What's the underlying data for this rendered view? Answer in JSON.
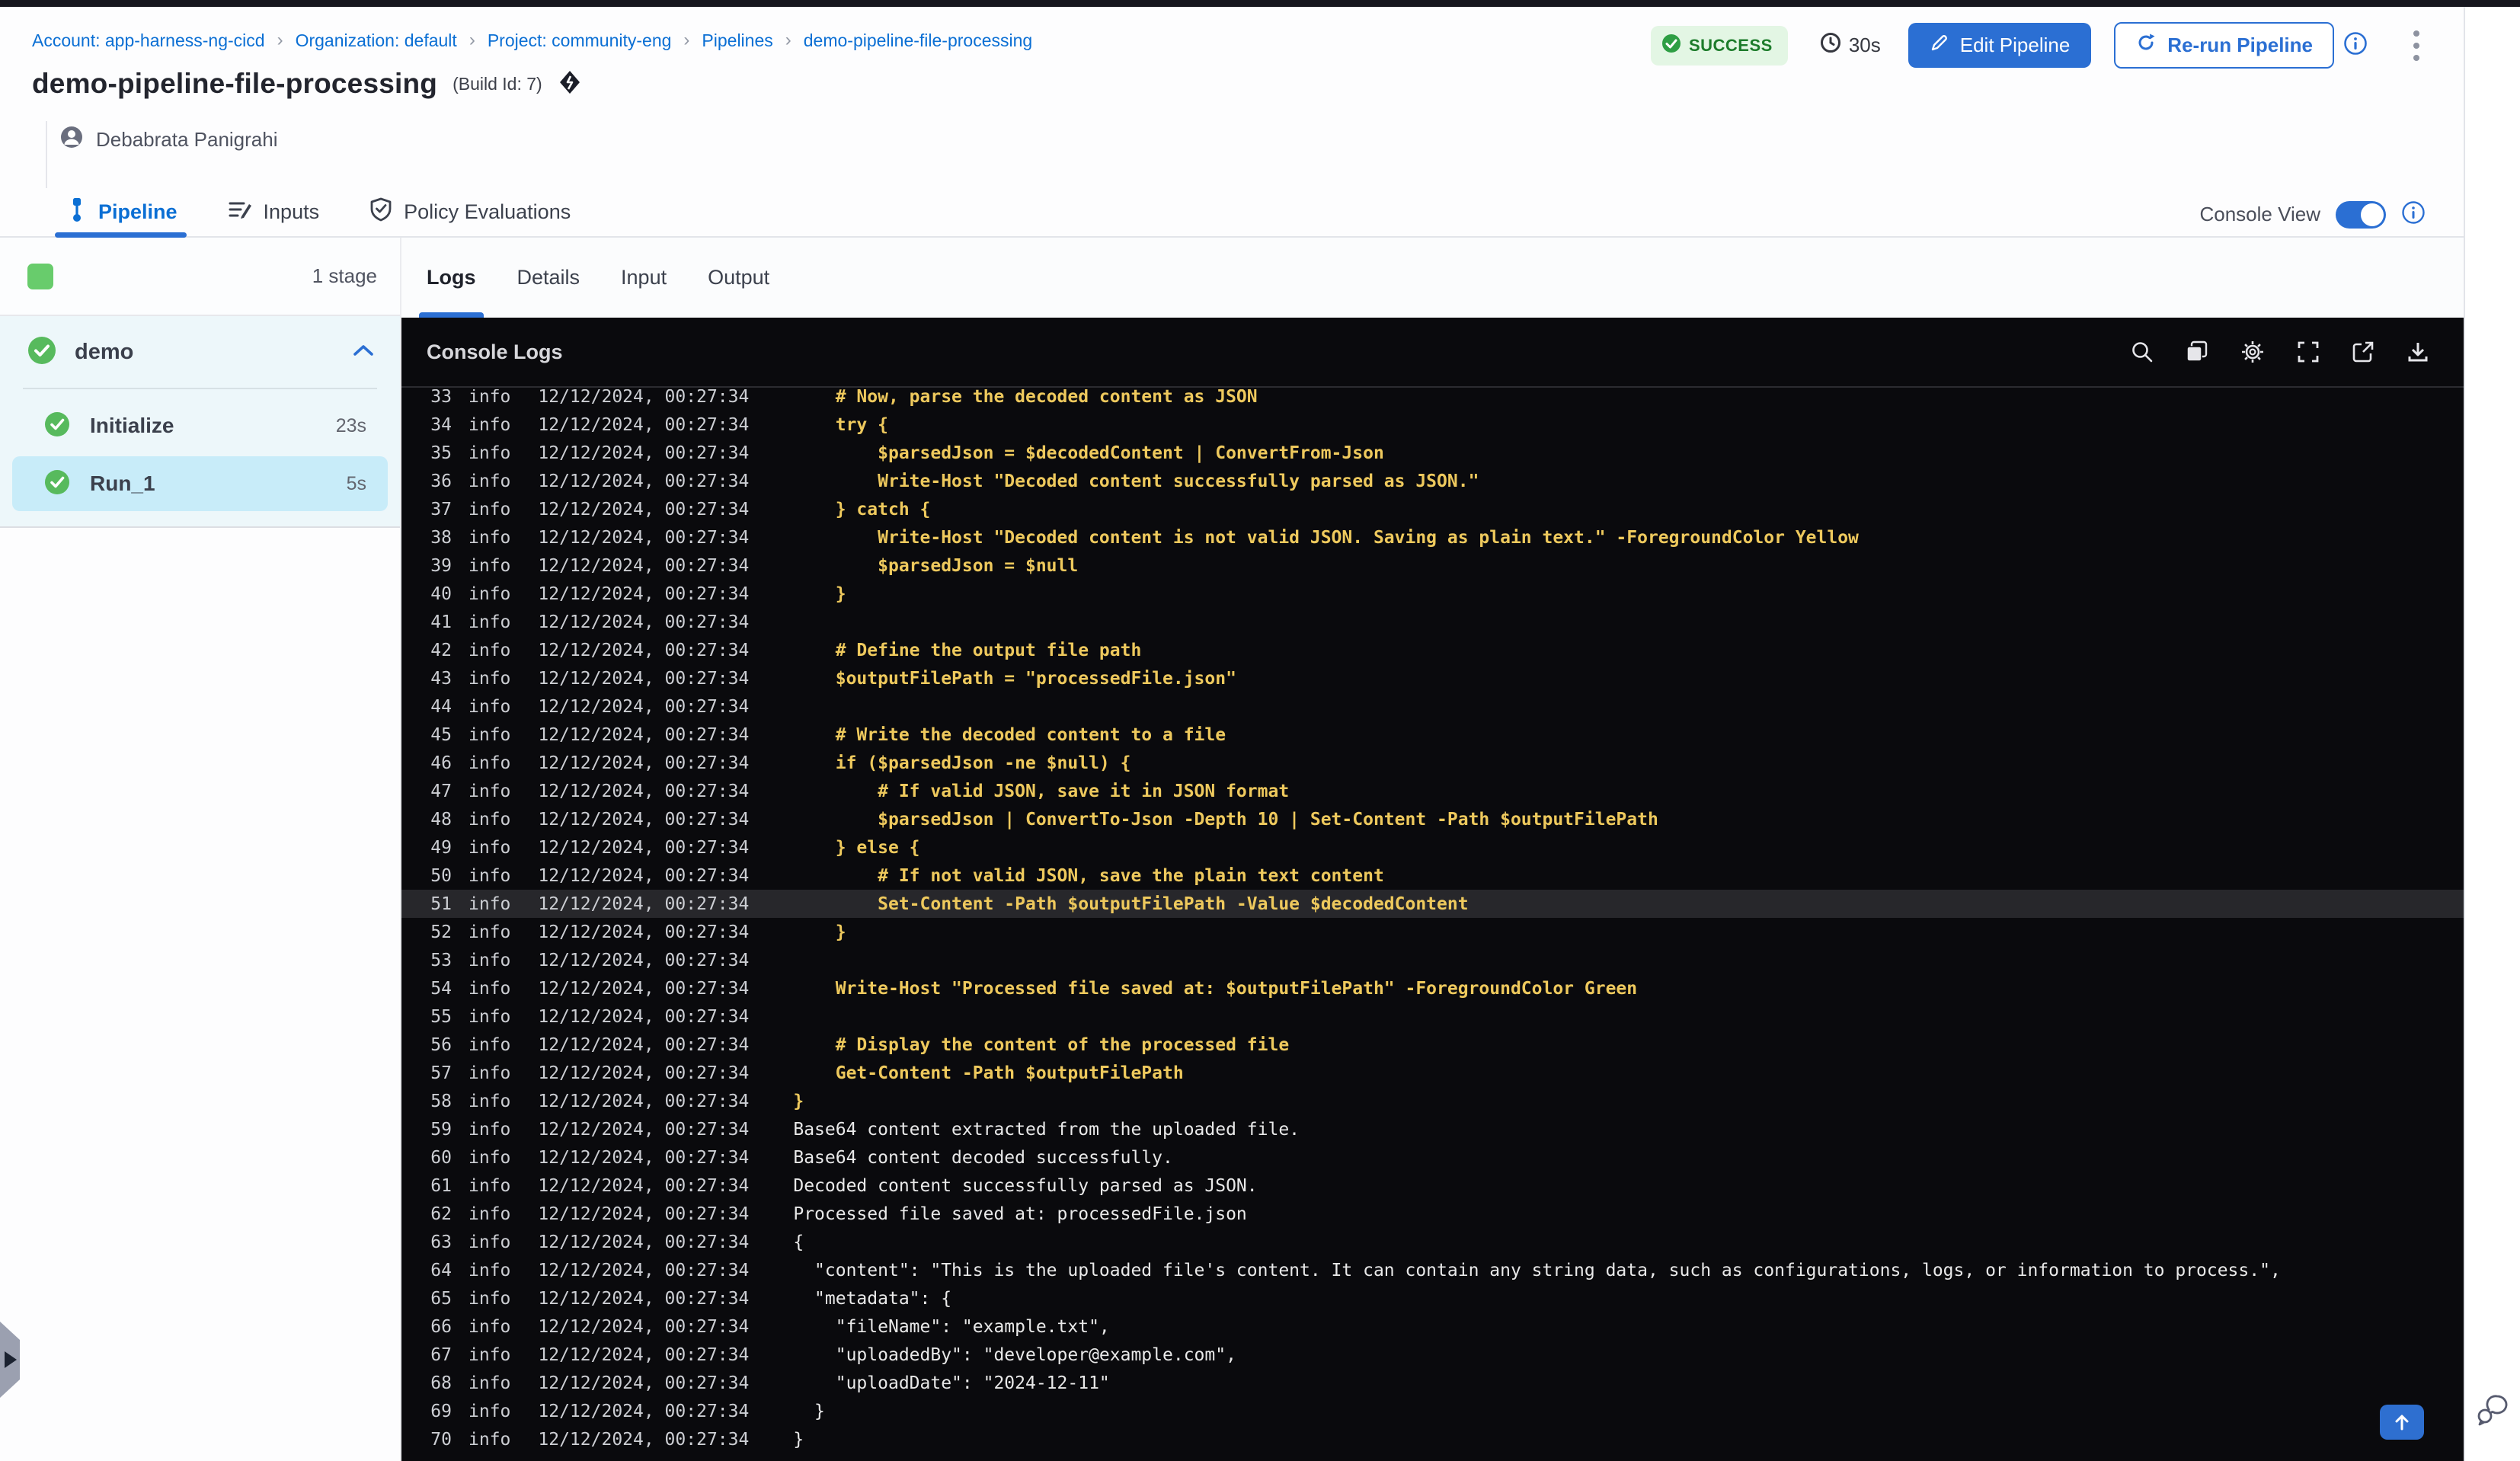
{
  "breadcrumb": {
    "separator": "›",
    "items": [
      "Account: app-harness-ng-cicd",
      "Organization: default",
      "Project: community-eng",
      "Pipelines",
      "demo-pipeline-file-processing"
    ]
  },
  "status": {
    "label": "SUCCESS",
    "duration": "30s"
  },
  "actions": {
    "edit": "Edit Pipeline",
    "rerun": "Re-run Pipeline"
  },
  "header": {
    "title": "demo-pipeline-file-processing",
    "build_id": "(Build Id: 7)",
    "author": "Debabrata Panigrahi"
  },
  "tabs": {
    "items": [
      {
        "label": "Pipeline",
        "icon": "pipeline-icon",
        "active": true
      },
      {
        "label": "Inputs",
        "icon": "inputs-icon",
        "active": false
      },
      {
        "label": "Policy Evaluations",
        "icon": "shield-check-icon",
        "active": false
      }
    ],
    "console_view_label": "Console View",
    "console_view_on": true
  },
  "stages": {
    "count_label": "1 stage",
    "group": {
      "name": "demo",
      "status": "success",
      "expanded": true
    },
    "steps": [
      {
        "name": "Initialize",
        "duration": "23s",
        "status": "success",
        "selected": false
      },
      {
        "name": "Run_1",
        "duration": "5s",
        "status": "success",
        "selected": true
      }
    ]
  },
  "log_tabs": {
    "items": [
      "Logs",
      "Details",
      "Input",
      "Output"
    ],
    "active": "Logs"
  },
  "console": {
    "title": "Console Logs",
    "toolbar_icons": [
      "search-icon",
      "copy-icon",
      "settings-icon",
      "fullscreen-icon",
      "open-in-new-icon",
      "download-icon"
    ],
    "level": "info",
    "timestamp": "12/12/2024, 00:27:34",
    "highlight_line": 51,
    "lines": [
      [
        33,
        "    # Now, parse the decoded content as JSON",
        "code"
      ],
      [
        34,
        "    try {",
        "code"
      ],
      [
        35,
        "        $parsedJson = $decodedContent | ConvertFrom-Json",
        "code"
      ],
      [
        36,
        "        Write-Host \"Decoded content successfully parsed as JSON.\"",
        "code"
      ],
      [
        37,
        "    } catch {",
        "code"
      ],
      [
        38,
        "        Write-Host \"Decoded content is not valid JSON. Saving as plain text.\" -ForegroundColor Yellow",
        "code"
      ],
      [
        39,
        "        $parsedJson = $null",
        "code"
      ],
      [
        40,
        "    }",
        "code"
      ],
      [
        41,
        "",
        "code"
      ],
      [
        42,
        "    # Define the output file path",
        "code"
      ],
      [
        43,
        "    $outputFilePath = \"processedFile.json\"",
        "code"
      ],
      [
        44,
        "",
        "code"
      ],
      [
        45,
        "    # Write the decoded content to a file",
        "code"
      ],
      [
        46,
        "    if ($parsedJson -ne $null) {",
        "code"
      ],
      [
        47,
        "        # If valid JSON, save it in JSON format",
        "code"
      ],
      [
        48,
        "        $parsedJson | ConvertTo-Json -Depth 10 | Set-Content -Path $outputFilePath",
        "code"
      ],
      [
        49,
        "    } else {",
        "code"
      ],
      [
        50,
        "        # If not valid JSON, save the plain text content",
        "code"
      ],
      [
        51,
        "        Set-Content -Path $outputFilePath -Value $decodedContent",
        "code"
      ],
      [
        52,
        "    }",
        "code"
      ],
      [
        53,
        "",
        "code"
      ],
      [
        54,
        "    Write-Host \"Processed file saved at: $outputFilePath\" -ForegroundColor Green",
        "code"
      ],
      [
        55,
        "",
        "code"
      ],
      [
        56,
        "    # Display the content of the processed file",
        "code"
      ],
      [
        57,
        "    Get-Content -Path $outputFilePath",
        "code"
      ],
      [
        58,
        "}",
        "code"
      ],
      [
        59,
        "Base64 content extracted from the uploaded file.",
        "out"
      ],
      [
        60,
        "Base64 content decoded successfully.",
        "out"
      ],
      [
        61,
        "Decoded content successfully parsed as JSON.",
        "out"
      ],
      [
        62,
        "Processed file saved at: processedFile.json",
        "out"
      ],
      [
        63,
        "{",
        "out"
      ],
      [
        64,
        "  \"content\": \"This is the uploaded file's content. It can contain any string data, such as configurations, logs, or information to process.\",",
        "out"
      ],
      [
        65,
        "  \"metadata\": {",
        "out"
      ],
      [
        66,
        "    \"fileName\": \"example.txt\",",
        "out"
      ],
      [
        67,
        "    \"uploadedBy\": \"developer@example.com\",",
        "out"
      ],
      [
        68,
        "    \"uploadDate\": \"2024-12-11\"",
        "out"
      ],
      [
        69,
        "  }",
        "out"
      ],
      [
        70,
        "}",
        "out"
      ]
    ]
  },
  "colors": {
    "accent_blue": "#2b6fd3",
    "link_blue": "#0b6fd4",
    "success_green": "#57ba5d",
    "success_badge_bg": "#e3f6e4",
    "success_badge_text": "#1d7c2b",
    "selected_step_bg": "#c8ecf9",
    "stage_section_bg": "#edf7fa",
    "console_bg": "#0a0a0d",
    "log_code": "#eec95d",
    "log_output": "#e9e9e9",
    "log_highlight_bg": "#27272b"
  }
}
